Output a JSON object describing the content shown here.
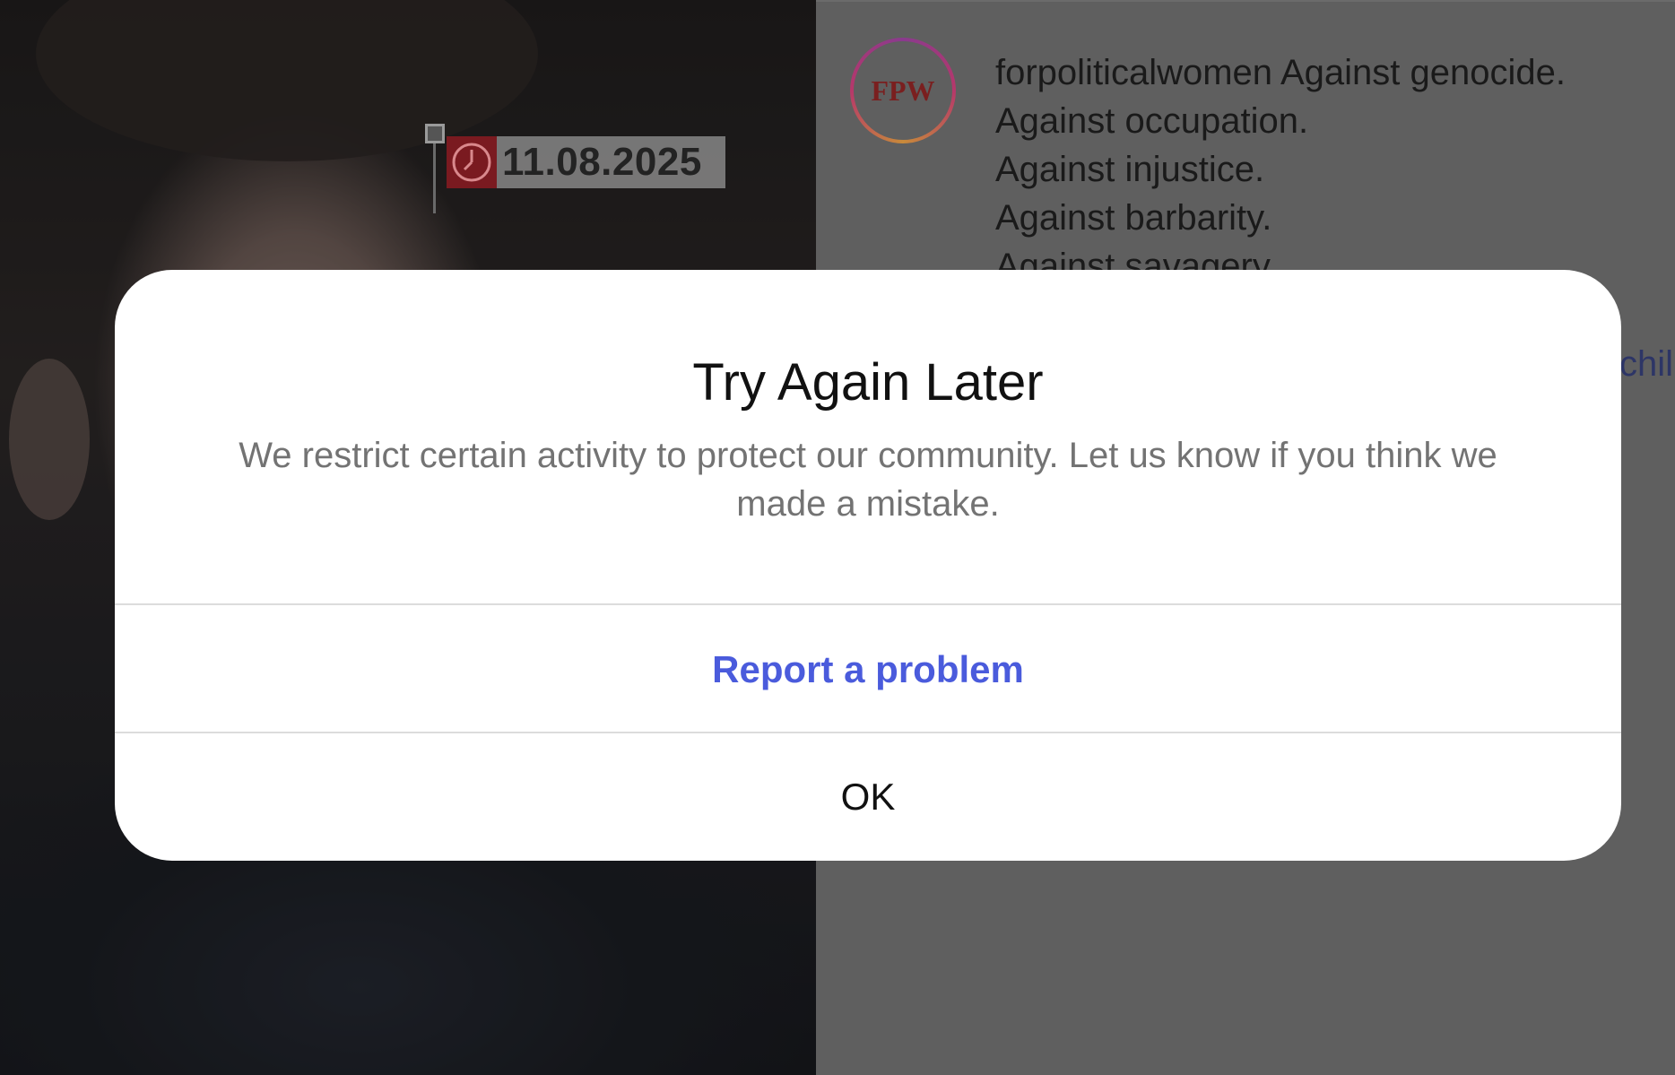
{
  "media": {
    "date_label": "11.08.2025",
    "icons": {
      "clock": "clock-icon"
    }
  },
  "post": {
    "avatar_text": "FPW",
    "username": "forpoliticalwomen",
    "caption_lines": [
      "Against genocide.",
      "Against occupation.",
      "Against injustice.",
      "Against barbarity.",
      "Against savagery."
    ],
    "link_fragment": "chil"
  },
  "dialog": {
    "title": "Try Again Later",
    "message": "We restrict certain activity to protect our community. Let us know if you think we made a mistake.",
    "report_label": "Report a problem",
    "ok_label": "OK"
  },
  "colors": {
    "accent_link": "#4a5bdc",
    "overlay": "#5e5e5e"
  }
}
